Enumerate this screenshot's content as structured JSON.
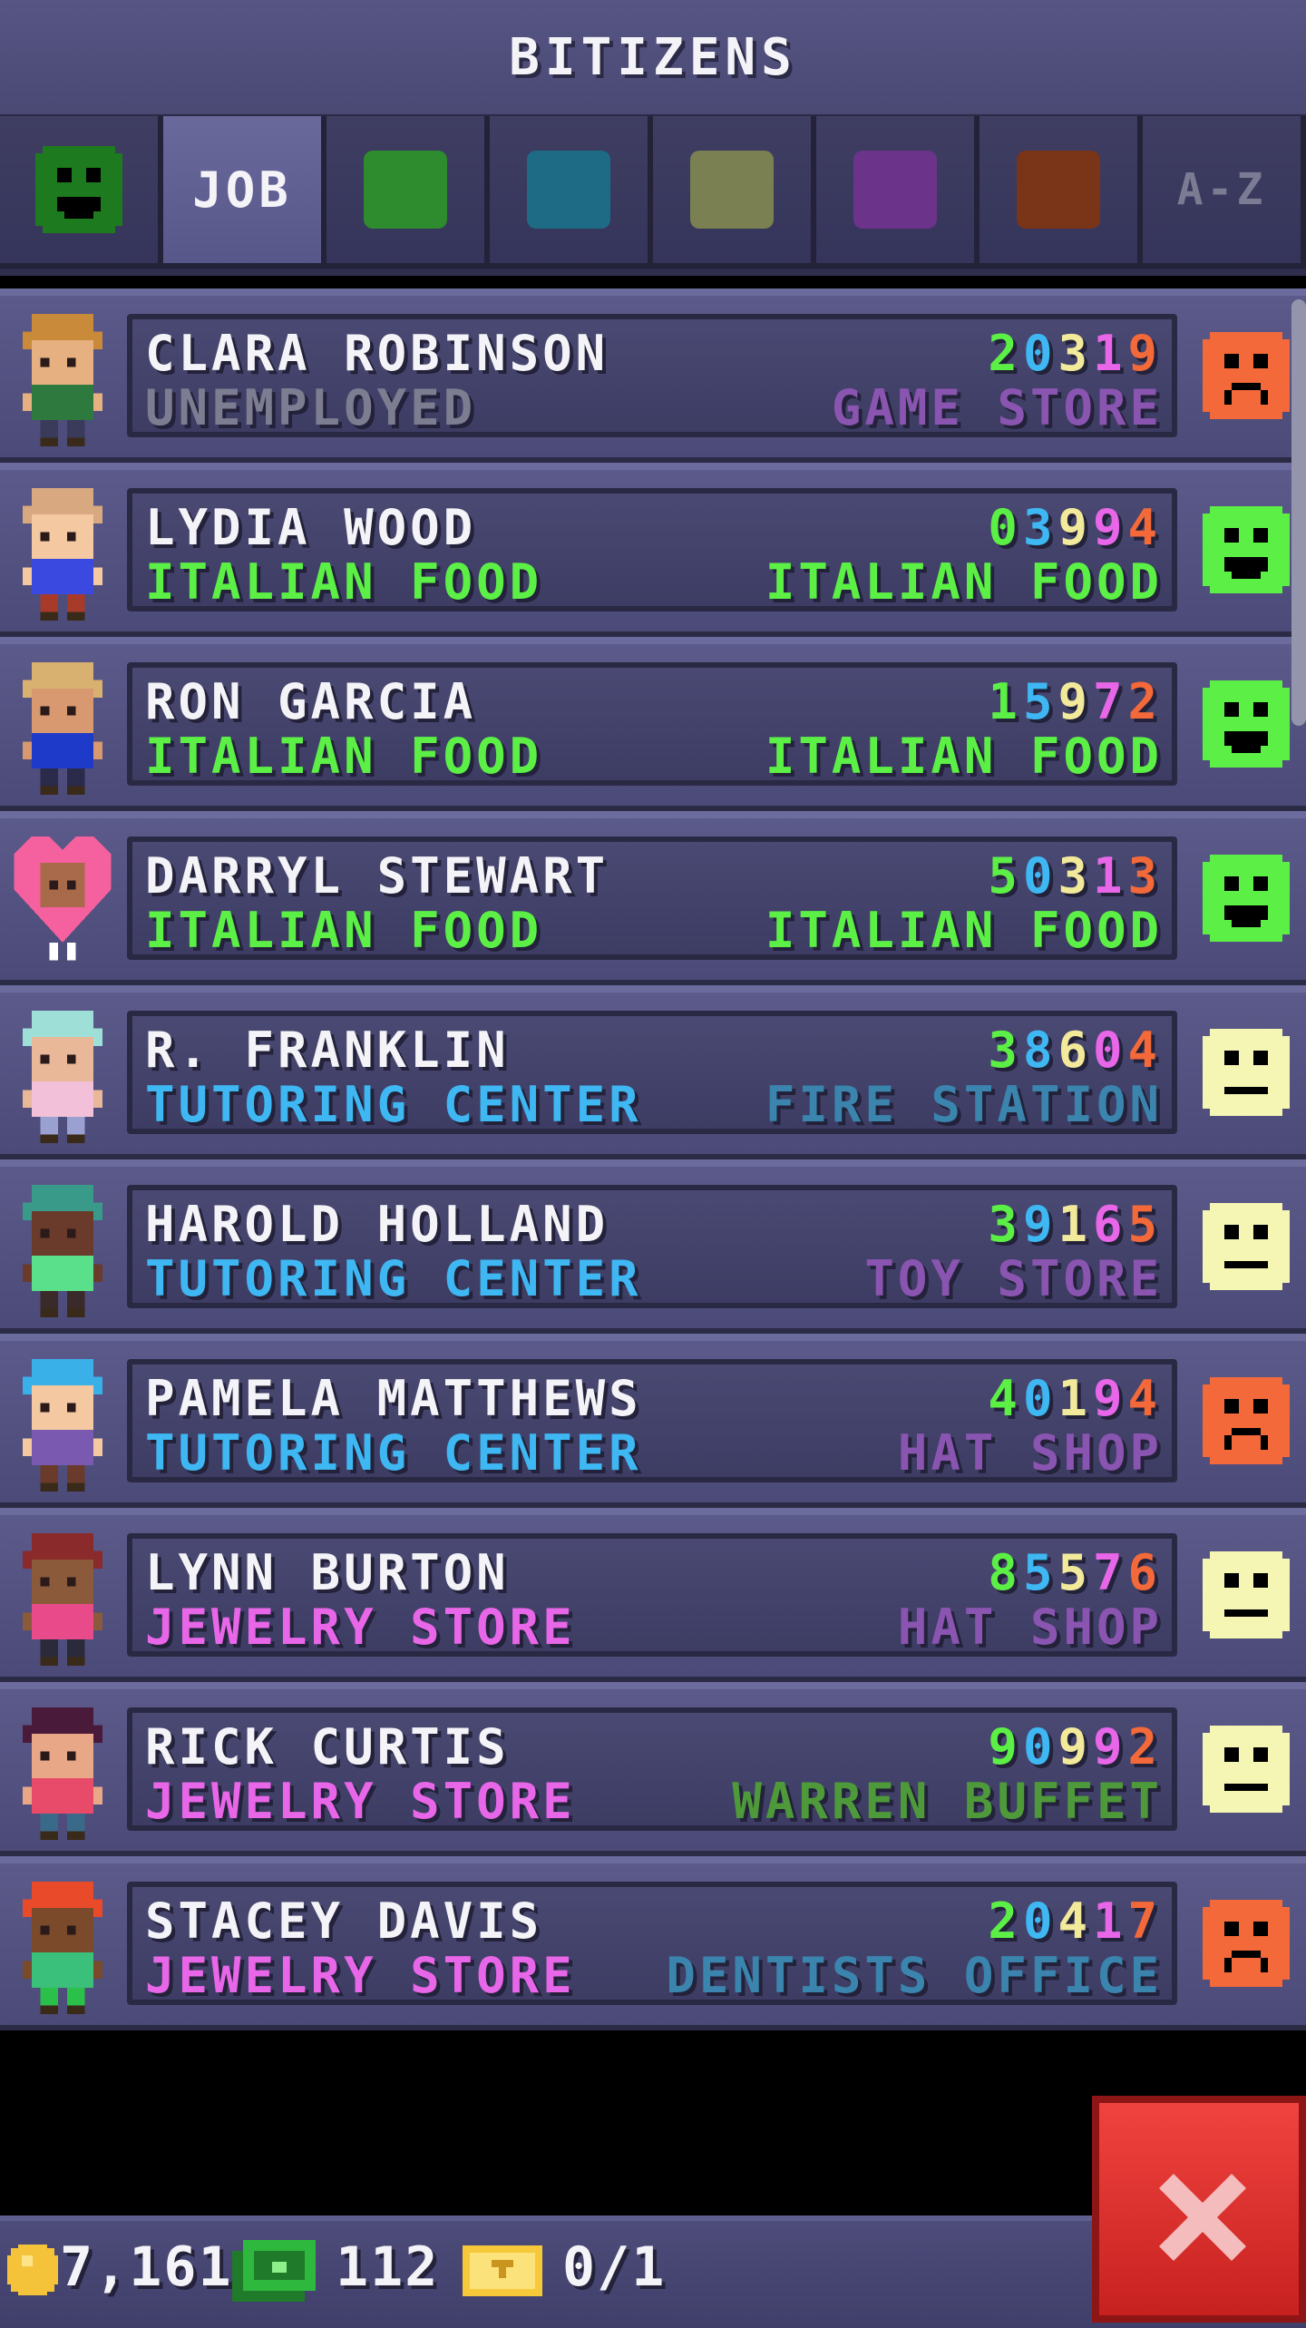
{
  "header": {
    "title": "BITIZENS"
  },
  "tabs": [
    {
      "type": "icon",
      "icon": "happy-face-icon",
      "color": "#1e7a1e",
      "active": false
    },
    {
      "type": "label",
      "label": "JOB",
      "active": true
    },
    {
      "type": "swatch",
      "color": "#2e8b2e",
      "active": false
    },
    {
      "type": "swatch",
      "color": "#1e6b86",
      "active": false
    },
    {
      "type": "swatch",
      "color": "#7a8052",
      "active": false
    },
    {
      "type": "swatch",
      "color": "#6c338a",
      "active": false
    },
    {
      "type": "swatch",
      "color": "#7a3418",
      "active": false
    },
    {
      "type": "label",
      "label": "A-Z",
      "active": false
    }
  ],
  "bitizens": [
    {
      "name": "CLARA ROBINSON",
      "job": "UNEMPLOYED",
      "job_color": "#7d7d92",
      "digits": [
        "2",
        "0",
        "3",
        "1",
        "9"
      ],
      "dream": "GAME STORE",
      "dream_color": "#8a55b0",
      "mood": "sad",
      "avatar": "clara-robinson"
    },
    {
      "name": "LYDIA WOOD",
      "job": "ITALIAN FOOD",
      "job_color": "#5cf046",
      "digits": [
        "0",
        "3",
        "9",
        "9",
        "4"
      ],
      "dream": "ITALIAN FOOD",
      "dream_color": "#5cf046",
      "mood": "happy",
      "avatar": "lydia-wood"
    },
    {
      "name": "RON GARCIA",
      "job": "ITALIAN FOOD",
      "job_color": "#5cf046",
      "digits": [
        "1",
        "5",
        "9",
        "7",
        "2"
      ],
      "dream": "ITALIAN FOOD",
      "dream_color": "#5cf046",
      "mood": "happy",
      "avatar": "ron-garcia"
    },
    {
      "name": "DARRYL STEWART",
      "job": "ITALIAN FOOD",
      "job_color": "#5cf046",
      "digits": [
        "5",
        "0",
        "3",
        "1",
        "3"
      ],
      "dream": "ITALIAN FOOD",
      "dream_color": "#5cf046",
      "mood": "happy",
      "avatar": "darryl-stewart"
    },
    {
      "name": "R. FRANKLIN",
      "job": "TUTORING CENTER",
      "job_color": "#3eb7f2",
      "digits": [
        "3",
        "8",
        "6",
        "0",
        "4"
      ],
      "dream": "FIRE STATION",
      "dream_color": "#3a84ad",
      "mood": "neutral",
      "avatar": "r-franklin"
    },
    {
      "name": "HAROLD HOLLAND",
      "job": "TUTORING CENTER",
      "job_color": "#3eb7f2",
      "digits": [
        "3",
        "9",
        "1",
        "6",
        "5"
      ],
      "dream": "TOY STORE",
      "dream_color": "#8a55b0",
      "mood": "neutral",
      "avatar": "harold-holland"
    },
    {
      "name": "PAMELA MATTHEWS",
      "job": "TUTORING CENTER",
      "job_color": "#3eb7f2",
      "digits": [
        "4",
        "0",
        "1",
        "9",
        "4"
      ],
      "dream": "HAT SHOP",
      "dream_color": "#8a55b0",
      "mood": "sad",
      "avatar": "pamela-matthews"
    },
    {
      "name": "LYNN BURTON",
      "job": "JEWELRY STORE",
      "job_color": "#e866e8",
      "digits": [
        "8",
        "5",
        "5",
        "7",
        "6"
      ],
      "dream": "HAT SHOP",
      "dream_color": "#8a55b0",
      "mood": "neutral",
      "avatar": "lynn-burton"
    },
    {
      "name": "RICK CURTIS",
      "job": "JEWELRY STORE",
      "job_color": "#e866e8",
      "digits": [
        "9",
        "0",
        "9",
        "9",
        "2"
      ],
      "dream": "WARREN BUFFET",
      "dream_color": "#4e9a3a",
      "mood": "neutral",
      "avatar": "rick-curtis"
    },
    {
      "name": "STACEY DAVIS",
      "job": "JEWELRY STORE",
      "job_color": "#e866e8",
      "digits": [
        "2",
        "0",
        "4",
        "1",
        "7"
      ],
      "dream": "DENTISTS OFFICE",
      "dream_color": "#3a84ad",
      "mood": "sad",
      "avatar": "stacey-davis"
    }
  ],
  "digit_colors": [
    "#5cf046",
    "#3eb7f2",
    "#f2ea9a",
    "#e866e8",
    "#f4693a"
  ],
  "mood_colors": {
    "happy": "#5cf046",
    "neutral": "#f6f6b4",
    "sad": "#f4693a"
  },
  "footer": {
    "coins": "7,161",
    "bux": "112",
    "tickets": "0/1"
  },
  "close_button": {
    "icon": "close-icon",
    "color": "#e8322e"
  }
}
